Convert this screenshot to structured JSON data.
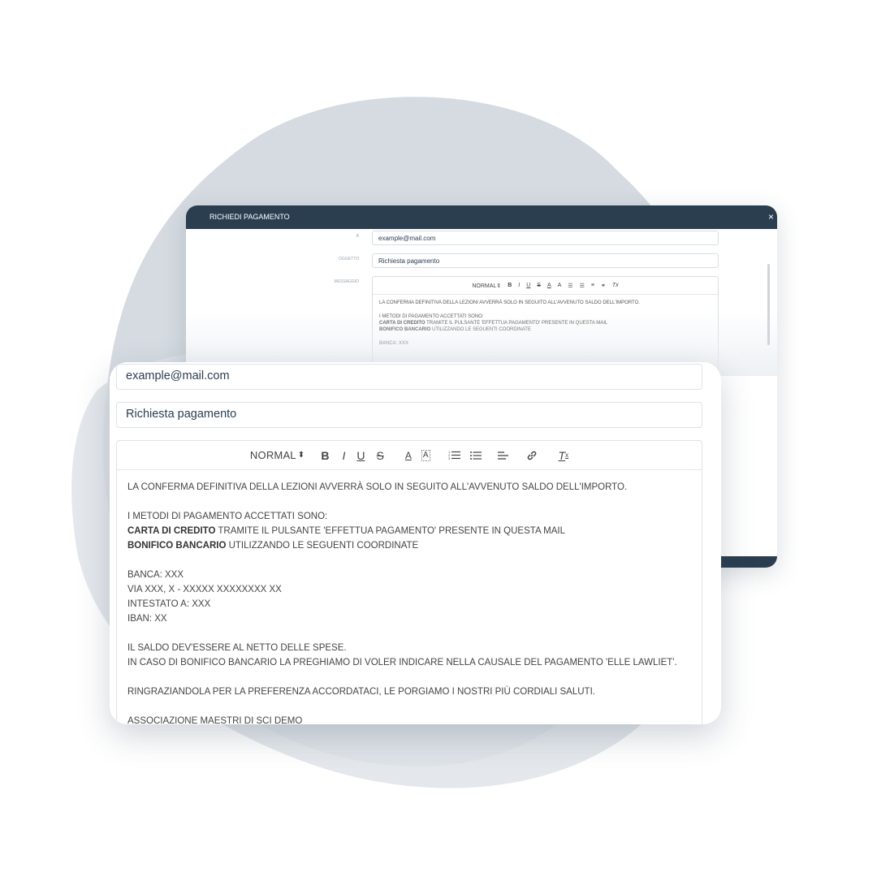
{
  "colors": {
    "header_bg": "#2b3e50",
    "blob": "#c9d1d9",
    "field_border": "#dfe3e7"
  },
  "back_modal": {
    "title": "RICHIEDI PAGAMENTO",
    "close_icon": "×",
    "labels": {
      "to": "A",
      "subject": "OGGETTO",
      "message": "MESSAGGIO"
    },
    "to_value": "example@mail.com",
    "subject_value": "Richiesta pagamento"
  },
  "form": {
    "to_value": "example@mail.com",
    "subject_value": "Richiesta pagamento"
  },
  "toolbar": {
    "format": "NORMAL",
    "format_arrows": "⇕",
    "bold": "B",
    "italic": "I",
    "underline": "U",
    "strike": "S",
    "text_color": "A",
    "bg_color": "A",
    "ordered_list": "⒈",
    "bullet_list": "☰",
    "align": "≡",
    "link": "🔗",
    "clear": "Tx"
  },
  "message": {
    "line1": "LA CONFERMA DEFINITIVA DELLA LEZIONI AVVERRÀ SOLO IN SEGUITO ALL'AVVENUTO SALDO DELL'IMPORTO.",
    "line2": "I METODI DI PAGAMENTO ACCETTATI SONO:",
    "card_bold": "CARTA DI CREDITO",
    "card_rest": " TRAMITE IL PULSANTE 'EFFETTUA PAGAMENTO' PRESENTE IN QUESTA MAIL",
    "bank_bold": "BONIFICO BANCARIO",
    "bank_rest": " UTILIZZANDO LE SEGUENTI COORDINATE",
    "banca": "BANCA: XXX",
    "via": "VIA XXX, X - XXXXX XXXXXXXX XX",
    "intestato": "INTESTATO A: XXX",
    "iban": "IBAN: XX",
    "saldo": "IL SALDO DEV'ESSERE AL NETTO DELLE SPESE.",
    "causale": "IN CASO DI BONIFICO BANCARIO LA PREGHIAMO DI VOLER INDICARE NELLA CAUSALE DEL PAGAMENTO 'ELLE LAWLIET'.",
    "ringraziamento": "RINGRAZIANDOLA PER LA PREFERENZA ACCORDATACI, LE PORGIAMO I NOSTRI PIÙ CORDIALI SALUTI.",
    "firma": "ASSOCIAZIONE MAESTRI DI SCI DEMO"
  }
}
